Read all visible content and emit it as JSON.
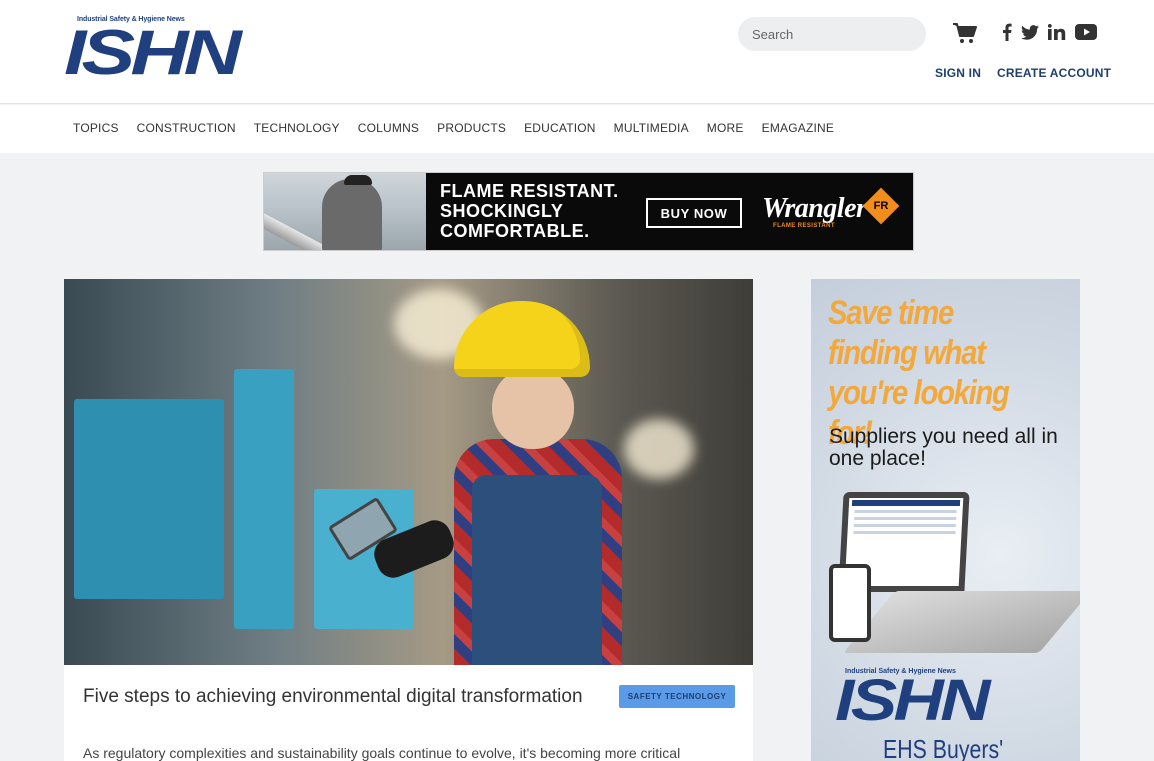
{
  "brand": {
    "tagline": "Industrial Safety & Hygiene News",
    "logo": "ISHN"
  },
  "header": {
    "search_placeholder": "Search",
    "search_icon": "search-icon",
    "cart_icon": "cart-icon",
    "social": [
      "facebook-icon",
      "twitter-icon",
      "linkedin-icon",
      "youtube-icon"
    ],
    "sign_in": "SIGN IN",
    "create_account": "CREATE ACCOUNT",
    "accent_color": "#1f3f7e"
  },
  "nav": {
    "items": [
      "TOPICS",
      "CONSTRUCTION",
      "TECHNOLOGY",
      "COLUMNS",
      "PRODUCTS",
      "EDUCATION",
      "MULTIMEDIA",
      "MORE",
      "EMAGAZINE"
    ]
  },
  "banner_ad": {
    "line1": "FLAME RESISTANT.",
    "line2": "SHOCKINGLY",
    "line3": "COMFORTABLE.",
    "cta": "BUY NOW",
    "brand": "Wrangler",
    "badge": "FR",
    "brand_sub": "FLAME RESISTANT"
  },
  "article": {
    "title": "Five steps to achieving environmental digital transformation",
    "tag": "SAFETY TECHNOLOGY",
    "tag_color": "#5b9ae6",
    "excerpt": "As regulatory complexities and sustainability goals continue to evolve, it's becoming more critical"
  },
  "side_ad": {
    "headline": "Save time finding what you're looking for!",
    "sub": "Suppliers you need all in one place!",
    "tagline": "Industrial Safety & Hygiene News",
    "logo": "ISHN",
    "bottom": "EHS Buyers'"
  }
}
